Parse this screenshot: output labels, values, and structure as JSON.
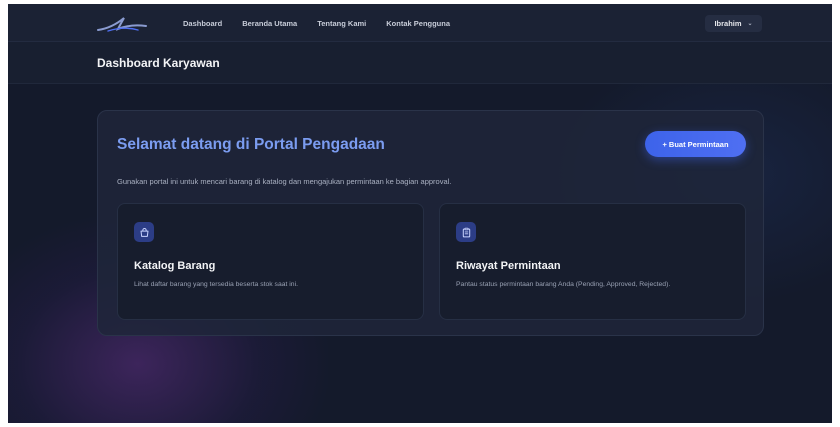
{
  "nav": {
    "links": [
      {
        "label": "Dashboard"
      },
      {
        "label": "Beranda Utama"
      },
      {
        "label": "Tentang Kami"
      },
      {
        "label": "Kontak Pengguna"
      }
    ],
    "user": {
      "name": "Ibrahim"
    }
  },
  "page": {
    "title": "Dashboard Karyawan"
  },
  "welcome": {
    "title": "Selamat datang di Portal Pengadaan",
    "cta_label": "+ Buat Permintaan",
    "description": "Gunakan portal ini untuk mencari barang di katalog dan mengajukan permintaan ke bagian approval."
  },
  "features": [
    {
      "icon": "shopping-bag-icon",
      "title": "Katalog Barang",
      "description": "Lihat daftar barang yang tersedia beserta stok saat ini."
    },
    {
      "icon": "clipboard-icon",
      "title": "Riwayat Permintaan",
      "description": "Pantau status permintaan barang Anda (Pending, Approved, Rejected)."
    }
  ],
  "colors": {
    "background": "#141a2b",
    "accent": "#3d63ea",
    "title_accent": "#7b9cf0",
    "icon_bg": "#2c3d86"
  }
}
